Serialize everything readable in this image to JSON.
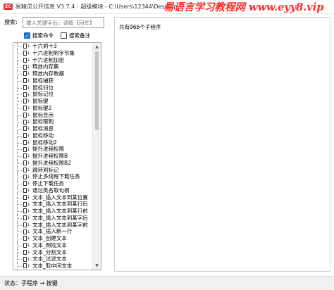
{
  "window": {
    "title": "易精灵公开信息 V3.7.4 - 超级模块 - C:\\Users\\12344\\Desktop\\超级模块",
    "icon_label": "EC"
  },
  "watermark": "易语言学习教程网 www.eyy8.vip",
  "search": {
    "label": "搜索:",
    "placeholder": "输入关键字后，请按【回车】",
    "value": ""
  },
  "options": [
    {
      "label": "搜索命令",
      "checked": true
    },
    {
      "label": "搜索备注",
      "checked": false
    }
  ],
  "commands": [
    "十六到十3",
    "十六进制到字节集",
    "十六进制加密",
    "释放内存集",
    "释放内存数据",
    "鼠标捕获",
    "鼠标归位",
    "鼠标记位",
    "鼠标键",
    "鼠标键2",
    "鼠标显示",
    "鼠标限制",
    "鼠标消息",
    "鼠标移动",
    "鼠标移动2",
    "提升进程权限",
    "提升进程权限B",
    "提升进程权限B2",
    "跳转到标记",
    "停止多线程下载任务",
    "停止下载任务",
    "通过类名取句柄",
    "文本_插入文本到某位置",
    "文本_插入文本到某行后",
    "文本_插入文本到某行前",
    "文本_插入文本到某字后",
    "文本_插入文本到某字前",
    "文本_插入新一行",
    "文本_创建文本",
    "文本_倒找文本",
    "文本_分割文本",
    "文本_过滤文本",
    "文本_取中间文本"
  ],
  "content": {
    "count_text": "共有966个子程序"
  },
  "status": {
    "text": "状态：子程序 → 按键"
  },
  "colors": {
    "watermark": "#ff2a2a",
    "checkbox_accent": "#1b6fd1",
    "app_icon": "#d9342b"
  }
}
